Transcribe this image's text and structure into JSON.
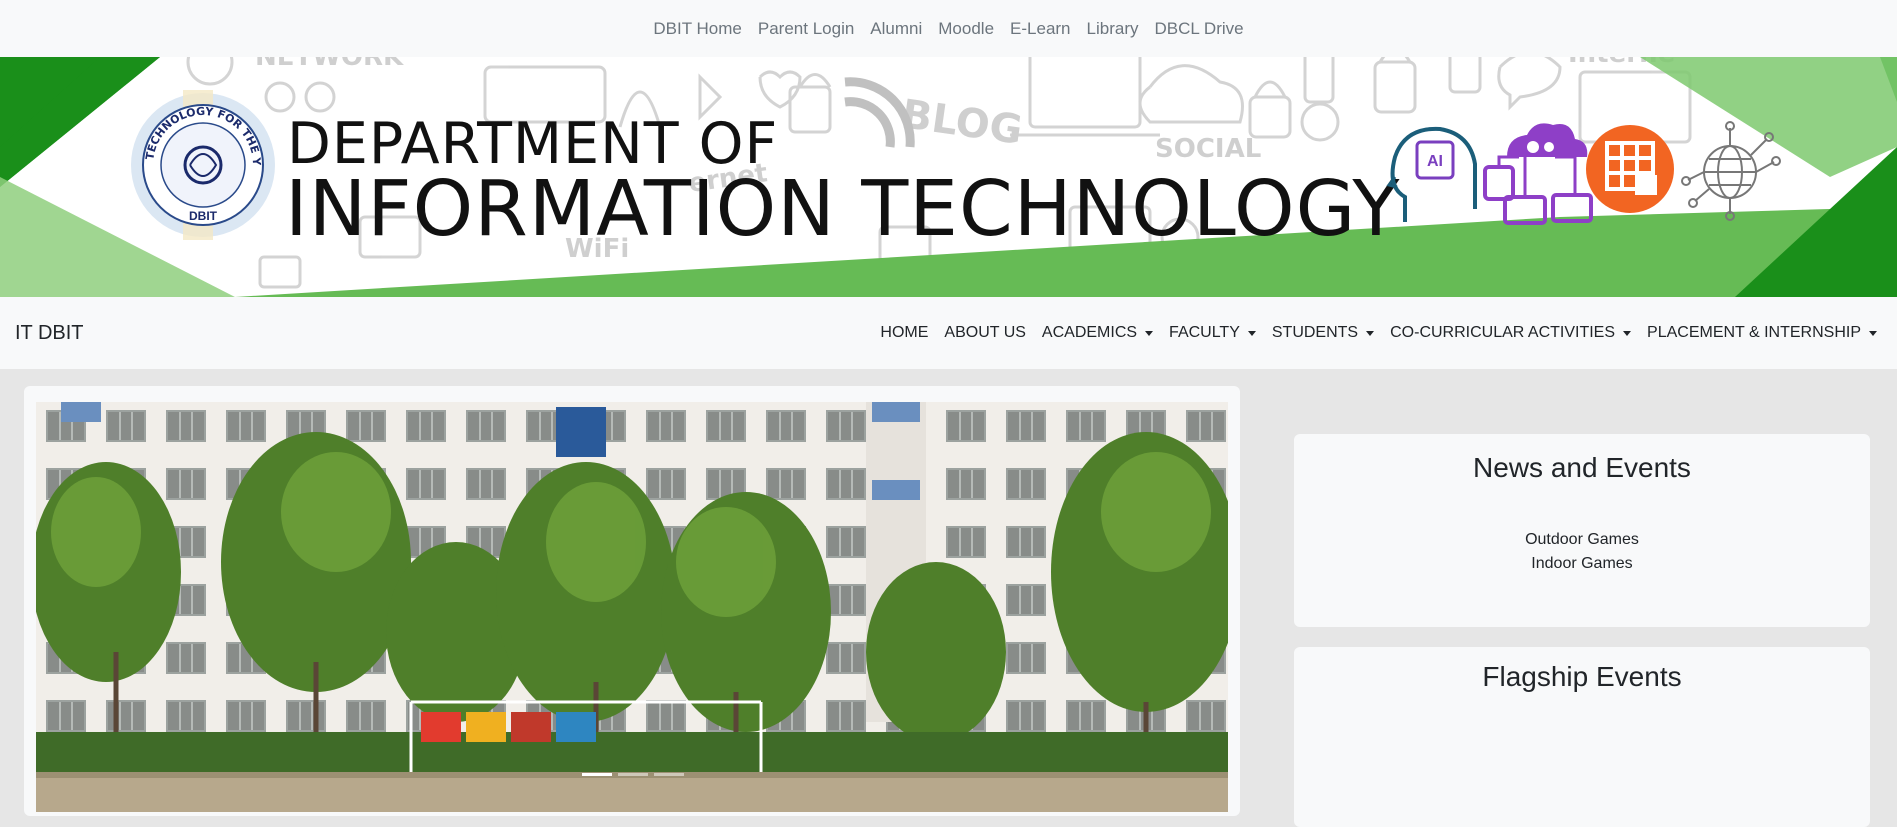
{
  "topbar": {
    "links": [
      "DBIT Home",
      "Parent Login",
      "Alumni",
      "Moodle",
      "E-Learn",
      "Library",
      "DBCL Drive"
    ]
  },
  "banner": {
    "title_line1": "DEPARTMENT OF",
    "title_line2": "INFORMATION TECHNOLOGY",
    "logo_text_top": "TECHNOLOGY FOR THE YOUNG",
    "logo_text_bottom": "DBIT",
    "ai_chip_text": "AI",
    "bg_doodle_words": [
      "NETWORK",
      "BLOG",
      "SOCIAL",
      "WiFi",
      "ernet",
      "Interne"
    ],
    "colors": {
      "green_dark": "#1a8f1a",
      "green_light": "#66bb55",
      "orange": "#f26522",
      "purple": "#8e3fc7",
      "teal": "#1b5e7a"
    }
  },
  "navbar": {
    "brand": "IT DBIT",
    "items": [
      {
        "label": "HOME",
        "dropdown": false
      },
      {
        "label": "ABOUT US",
        "dropdown": false
      },
      {
        "label": "ACADEMICS",
        "dropdown": true
      },
      {
        "label": "FACULTY",
        "dropdown": true
      },
      {
        "label": "STUDENTS",
        "dropdown": true
      },
      {
        "label": "CO-CURRICULAR ACTIVITIES",
        "dropdown": true
      },
      {
        "label": "PLACEMENT & INTERNSHIP",
        "dropdown": true
      }
    ]
  },
  "carousel": {
    "slide_count": 3,
    "active_index": 0
  },
  "news": {
    "title": "News and Events",
    "links": [
      "Outdoor Games",
      "Indoor Games"
    ]
  },
  "flagship": {
    "title": "Flagship Events"
  }
}
